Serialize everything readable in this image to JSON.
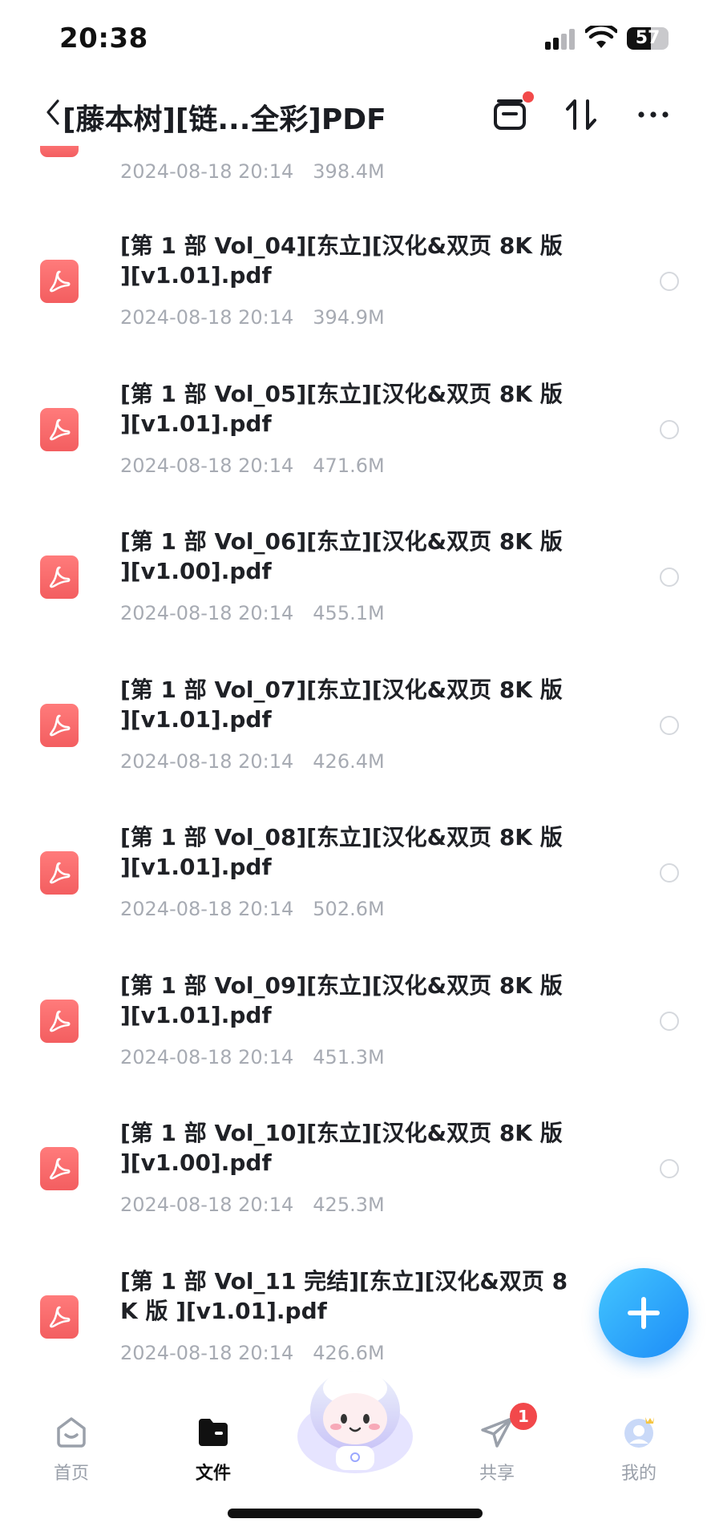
{
  "status_bar": {
    "time": "20:38",
    "battery": "57"
  },
  "nav": {
    "title": "[藤本树][链...全彩]PDF"
  },
  "top_partial_item": {
    "date": "2024-08-18 20:14",
    "size": "398.4M"
  },
  "files": [
    {
      "name": "[第 1 部 Vol_04][东立][汉化&双页 8K 版 ][v1.01].pdf",
      "date": "2024-08-18 20:14",
      "size": "394.9M"
    },
    {
      "name": "[第 1 部 Vol_05][东立][汉化&双页 8K 版 ][v1.01].pdf",
      "date": "2024-08-18 20:14",
      "size": "471.6M"
    },
    {
      "name": "[第 1 部 Vol_06][东立][汉化&双页 8K 版 ][v1.00].pdf",
      "date": "2024-08-18 20:14",
      "size": "455.1M"
    },
    {
      "name": "[第 1 部 Vol_07][东立][汉化&双页 8K 版 ][v1.01].pdf",
      "date": "2024-08-18 20:14",
      "size": "426.4M"
    },
    {
      "name": "[第 1 部 Vol_08][东立][汉化&双页 8K 版 ][v1.01].pdf",
      "date": "2024-08-18 20:14",
      "size": "502.6M"
    },
    {
      "name": "[第 1 部 Vol_09][东立][汉化&双页 8K 版 ][v1.01].pdf",
      "date": "2024-08-18 20:14",
      "size": "451.3M"
    },
    {
      "name": "[第 1 部 Vol_10][东立][汉化&双页 8K 版 ][v1.00].pdf",
      "date": "2024-08-18 20:14",
      "size": "425.3M"
    },
    {
      "name": "[第 1 部 Vol_11 完结][东立][汉化&双页 8K 版 ][v1.01].pdf",
      "date": "2024-08-18 20:14",
      "size": "426.6M"
    }
  ],
  "tabs": {
    "home": "首页",
    "files": "文件",
    "share": "共享",
    "me": "我的",
    "share_badge": "1"
  },
  "colors": {
    "accent": "#1d8cf7",
    "pdf_red": "#f35e60",
    "meta_gray": "#a7abb3"
  }
}
